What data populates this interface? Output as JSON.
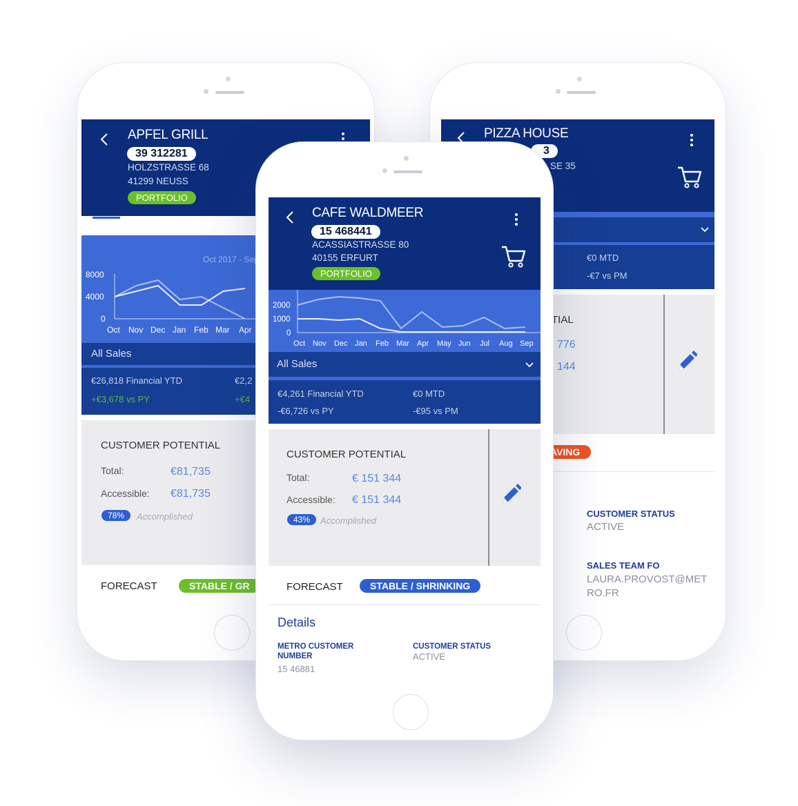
{
  "left": {
    "name": "APFEL GRILL",
    "number": "39 312281",
    "street": "HOLZSTRASSE 68",
    "city": "41299 NEUSS",
    "tag": "PORTFOLIO",
    "chart_range": "Oct 2017 - Sep",
    "chart_yticks": [
      "8000",
      "4000",
      "0"
    ],
    "chart_xticks": [
      "Oct",
      "Nov",
      "Dec",
      "Jan",
      "Feb",
      "Mar",
      "Apr"
    ],
    "all_sales": "All Sales",
    "ytd": "€26,818  Financial YTD",
    "ytd_delta": "+€3,678  vs PY",
    "mtd": "€2,2",
    "mtd_delta": "+€4",
    "potential_title": "CUSTOMER POTENTIAL",
    "total_label": "Total:",
    "total_value": "€81,735",
    "accessible_label": "Accessible:",
    "accessible_value": "€81,735",
    "pct": "78%",
    "accomplished": "Accomplished",
    "forecast_label": "FORECAST",
    "forecast_value": "STABLE / GR"
  },
  "right": {
    "name": "PIZZA HOUSE",
    "number_frag": "3",
    "street_frag": "SE 35",
    "mtd": "€0  MTD",
    "mtd_delta": "-€7  vs PM",
    "potential_frag": "TIAL",
    "val1_frag": "776",
    "val2_frag": "144",
    "status_pill": "AVING",
    "customer_status_label": "CUSTOMER STATUS",
    "customer_status_value": "ACTIVE",
    "sales_team_label": "SALES TEAM FO",
    "sales_team_value_1": "LAURA.PROVOST@MET",
    "sales_team_value_2": "RO.FR"
  },
  "center": {
    "name": "CAFE WALDMEER",
    "number": "15 468441",
    "street": "ACASSIASTRASSE 80",
    "city": "40155 ERFURT",
    "tag": "PORTFOLIO",
    "chart_yticks": [
      "2000",
      "1000",
      "0"
    ],
    "chart_xticks": [
      "Oct",
      "Nov",
      "Dec",
      "Jan",
      "Feb",
      "Mar",
      "Apr",
      "May",
      "Jun",
      "Jul",
      "Aug",
      "Sep"
    ],
    "all_sales": "All Sales",
    "ytd": "€4,261  Financial YTD",
    "ytd_delta": "-€6,726  vs PY",
    "mtd": "€0  MTD",
    "mtd_delta": "-€95  vs PM",
    "potential_title": "CUSTOMER POTENTIAL",
    "total_label": "Total:",
    "total_value": "€ 151 344",
    "accessible_label": "Accessible:",
    "accessible_value": "€ 151 344",
    "pct": "43%",
    "accomplished": "Accomplished",
    "forecast_label": "FORECAST",
    "forecast_value": "STABLE / SHRINKING",
    "details_title": "Details",
    "metro_label": "METRO CUSTOMER NUMBER",
    "metro_value": "15 46881",
    "status_label": "CUSTOMER STATUS",
    "status_value": "ACTIVE"
  },
  "chart_data": [
    {
      "type": "line",
      "title": "",
      "x": [
        "Oct",
        "Nov",
        "Dec",
        "Jan",
        "Feb",
        "Mar",
        "Apr"
      ],
      "yticks": [
        0,
        4000,
        8000
      ],
      "series": [
        {
          "values": [
            4000,
            6000,
            7000,
            3500,
            4000,
            2000,
            0
          ]
        },
        {
          "values": [
            4000,
            5000,
            6000,
            2500,
            2500,
            5000,
            5500
          ]
        }
      ]
    },
    {
      "type": "line",
      "title": "",
      "x": [
        "Oct",
        "Nov",
        "Dec",
        "Jan",
        "Feb",
        "Mar",
        "Apr",
        "May",
        "Jun",
        "Jul",
        "Aug",
        "Sep"
      ],
      "yticks": [
        0,
        1000,
        2000
      ],
      "series": [
        {
          "values": [
            2000,
            2400,
            2600,
            2500,
            2300,
            300,
            1500,
            400,
            500,
            1100,
            300,
            400
          ]
        },
        {
          "values": [
            1000,
            1000,
            900,
            1000,
            300,
            50,
            50,
            50,
            50,
            50,
            50,
            50
          ]
        }
      ]
    }
  ],
  "colors": {
    "header": "#0b2d7b",
    "chart": "#3d6ad6",
    "green": "#6bbf2a",
    "blue": "#2e5fcf",
    "orange": "#f0531f"
  }
}
